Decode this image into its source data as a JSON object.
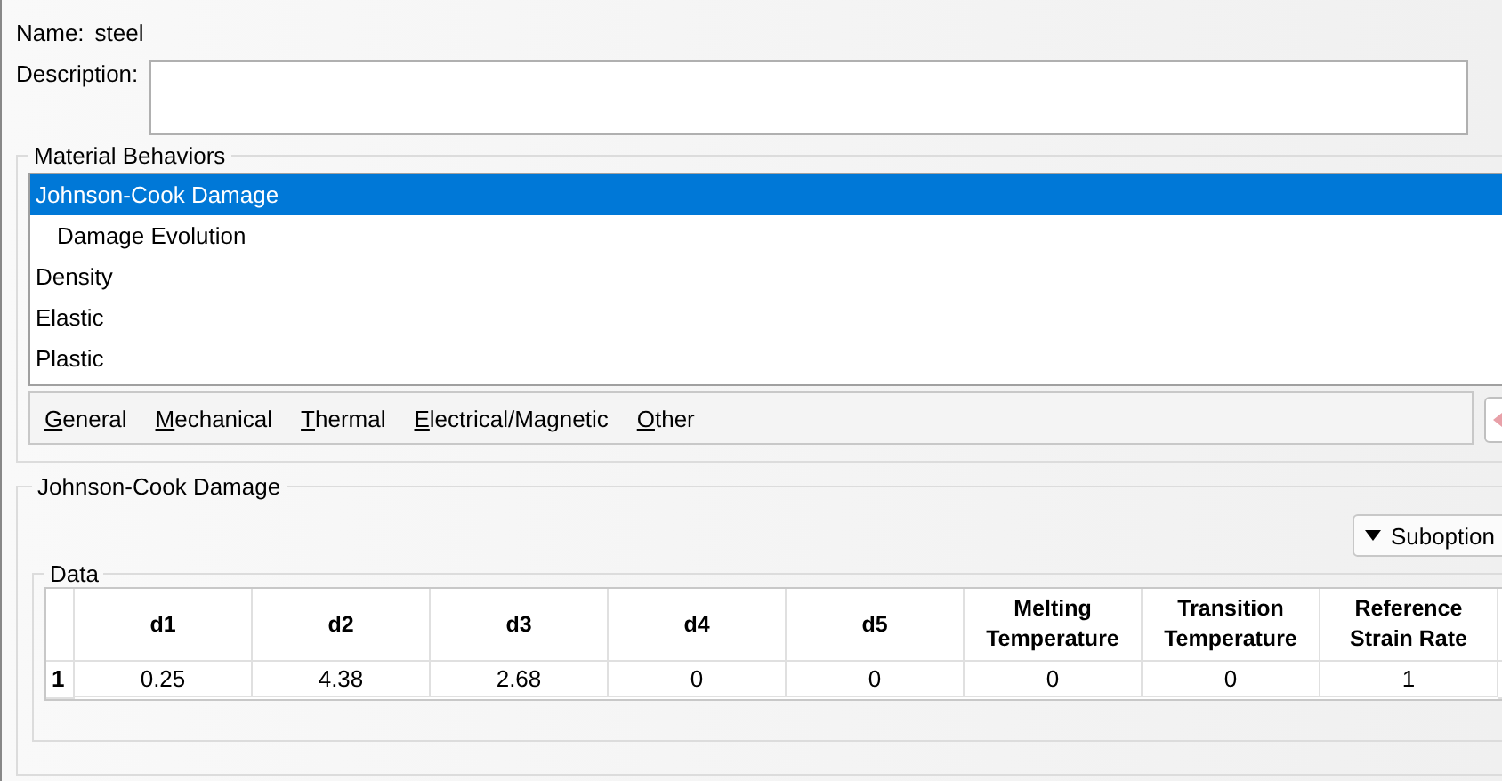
{
  "name": {
    "label": "Name:",
    "value": "steel"
  },
  "description": {
    "label": "Description:"
  },
  "material_behaviors": {
    "title": "Material Behaviors",
    "items": [
      {
        "label": "Johnson-Cook Damage",
        "selected": true,
        "children": [
          {
            "label": "Damage Evolution",
            "selected": false
          }
        ]
      },
      {
        "label": "Density",
        "selected": false
      },
      {
        "label": "Elastic",
        "selected": false
      },
      {
        "label": "Plastic",
        "selected": false
      }
    ]
  },
  "menus": [
    {
      "label": "General"
    },
    {
      "label": "Mechanical"
    },
    {
      "label": "Thermal"
    },
    {
      "label": "Electrical/Magnetic"
    },
    {
      "label": "Other"
    }
  ],
  "editor": {
    "title": "Johnson-Cook Damage",
    "suboptions": "Suboption",
    "data": {
      "title": "Data",
      "columns": [
        "d1",
        "d2",
        "d3",
        "d4",
        "d5",
        "Melting Temperature",
        "Transition Temperature",
        "Reference Strain Rate"
      ],
      "rows": [
        {
          "index": "1",
          "cells": [
            "0.25",
            "4.38",
            "2.68",
            "0",
            "0",
            "0",
            "0",
            "1"
          ]
        }
      ]
    }
  }
}
